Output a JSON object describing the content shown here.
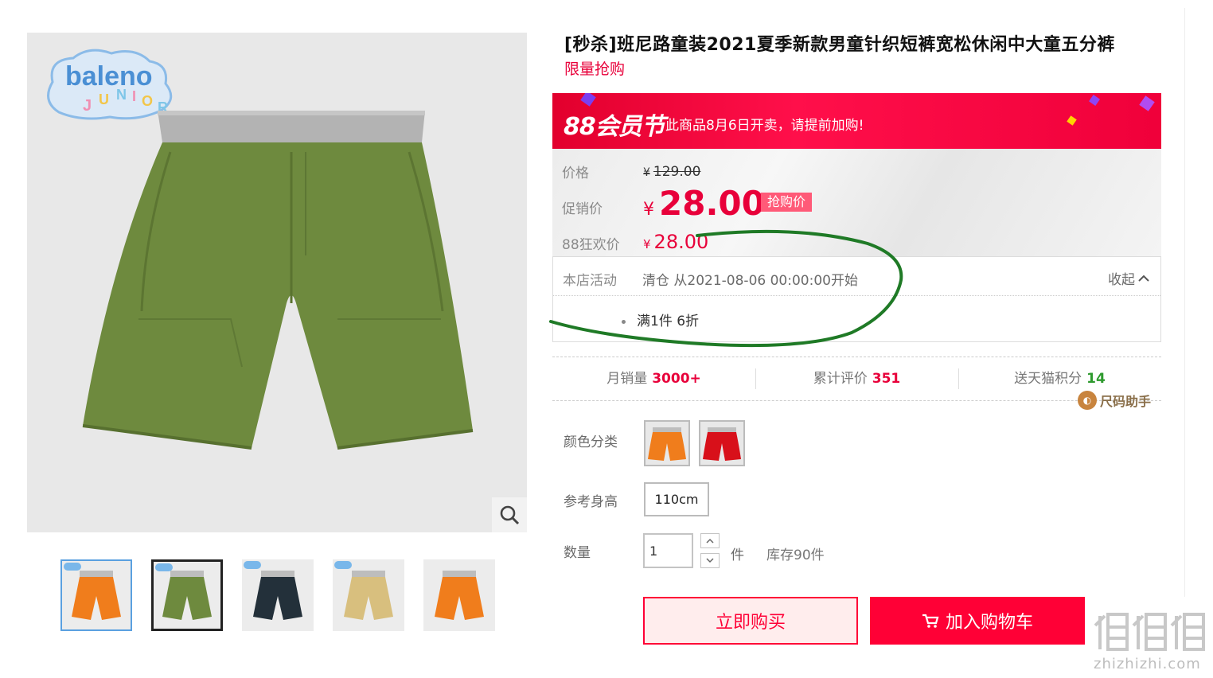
{
  "product": {
    "title": "[秒杀]班尼路童装2021夏季新款男童针织短裤宽松休闲中大童五分裤",
    "subtitle": "限量抢购"
  },
  "gallery": {
    "logo_alt": "baleno JUNIOR",
    "thumbnails": [
      {
        "color": "#f07d1c"
      },
      {
        "color": "#6e8a3e"
      },
      {
        "color": "#23303a"
      },
      {
        "color": "#d8bf7e"
      },
      {
        "color": "#f07d1c"
      }
    ]
  },
  "banner": {
    "tag": "88会员节",
    "message": "此商品8月6日开卖，请提前加购!"
  },
  "price": {
    "label": "价格",
    "currency": "¥",
    "original": "129.00",
    "promo_label": "促销价",
    "promo": "28.00",
    "promo_tag": "抢购价",
    "event_label": "88狂欢价",
    "event_price": "28.00"
  },
  "activity": {
    "label": "本店活动",
    "description": "清仓 从2021-08-06 00:00:00开始",
    "collapse": "收起",
    "item": "满1件 6折"
  },
  "stats": [
    {
      "label": "月销量",
      "value": "3000+"
    },
    {
      "label": "累计评价",
      "value": "351"
    },
    {
      "label": "送天猫积分",
      "value": "14"
    }
  ],
  "size_helper": "尺码助手",
  "options": {
    "color_label": "颜色分类",
    "colors": [
      "#f07d1c",
      "#d8101a"
    ],
    "height_label": "参考身高",
    "height_value": "110cm"
  },
  "quantity": {
    "label": "数量",
    "value": "1",
    "unit": "件",
    "stock": "库存90件"
  },
  "actions": {
    "buy_now": "立即购买",
    "add_cart": "加入购物车"
  },
  "watermark": {
    "site": "zhizhizhi.com"
  },
  "colors": {
    "accent": "#ff0036",
    "annotation": "#1f7a26"
  }
}
